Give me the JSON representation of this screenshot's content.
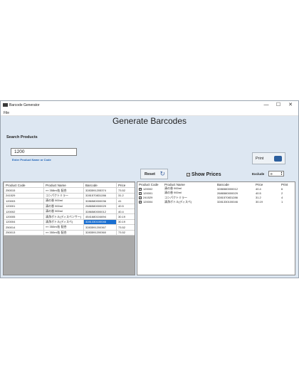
{
  "window": {
    "title": "Barcode Generator",
    "controls": [
      "—",
      "☐",
      "✕"
    ]
  },
  "menu": {
    "file": "File"
  },
  "heading": "Generate Barcodes",
  "search": {
    "label": "Search Products",
    "value": "1200",
    "hint": "Enter Product Name or Code"
  },
  "print_label": "Print",
  "reset_label": "Reset",
  "show_prices_label": "Show Prices",
  "exclude": {
    "label": "Exclude",
    "value": "0"
  },
  "left_table": {
    "headers": [
      "Product Code",
      "Product Name",
      "Barcode",
      "Price"
    ],
    "rows": [
      [
        "250015",
        "«« 358ml缶 配合",
        "3283591205374",
        "73.52"
      ],
      [
        "241529",
        "コンパクトミラー",
        "3281570831286",
        "31.2"
      ],
      [
        "120003",
        "清の香 900ml",
        "3286580000036",
        "41"
      ],
      [
        "120001",
        "清の香 900ml",
        "2686580000029",
        "40.5"
      ],
      [
        "120002",
        "清の香 900ml",
        "3286580000012",
        "40.4"
      ],
      [
        "120005",
        "清浄ボトル(ディスペンサー)",
        "4541680104694",
        "30.19"
      ],
      [
        "120004",
        "清浄ボトル(ディスペ)",
        "3281330100046",
        "30.19"
      ],
      [
        "250014",
        "«« 350ml缶 配合",
        "3283591200367",
        "73.52"
      ],
      [
        "250013",
        "«« 350ml缶 配合",
        "3283591200360",
        "73.52"
      ]
    ],
    "selected": {
      "row": 6,
      "col": 2
    }
  },
  "right_table": {
    "headers": [
      "Product Code",
      "Product Name",
      "Barcode",
      "Price",
      "Print"
    ],
    "rows": [
      [
        "120002",
        "清の香 900ml",
        "3286580000012",
        "40.4",
        "6"
      ],
      [
        "120001",
        "清の香 900ml",
        "2686580000029",
        "40.5",
        "2"
      ],
      [
        "241529",
        "コンパクトミラー",
        "3281570831286",
        "31.2",
        "4"
      ],
      [
        "120004",
        "清浄ボトル(ディスペ)",
        "3281330100046",
        "30.19",
        "1"
      ]
    ]
  },
  "colors": {
    "window_bg": "#dde7f2",
    "selection": "#1a6fd1",
    "hint": "#1a5fb4"
  }
}
